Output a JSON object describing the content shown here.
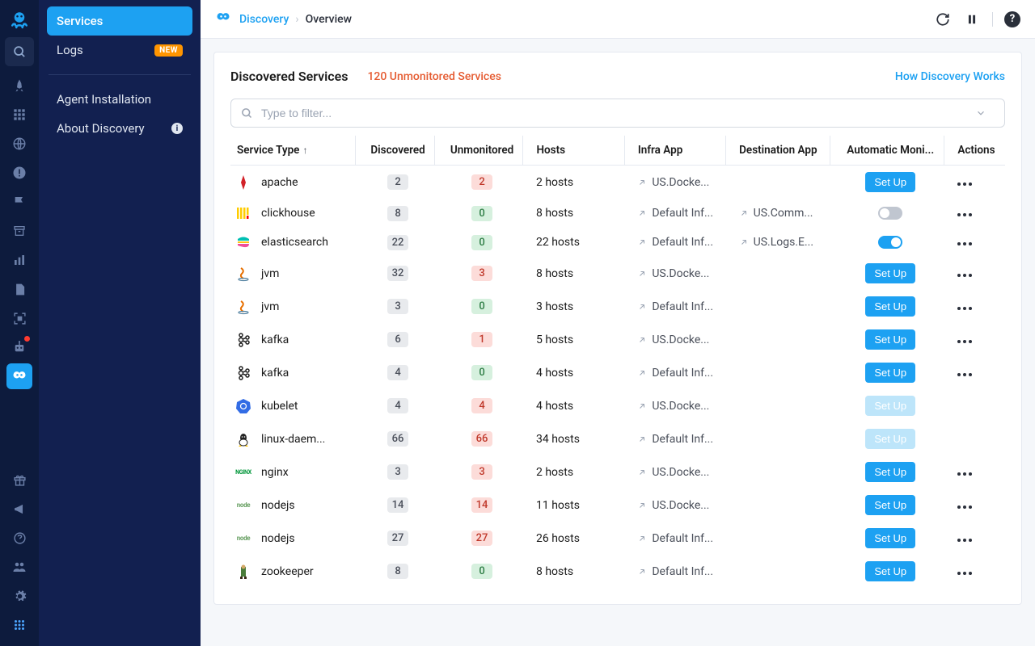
{
  "rail": {
    "icons": [
      "rocket",
      "grid",
      "globe",
      "alert",
      "flag",
      "archive",
      "chart",
      "file",
      "selection",
      "robot",
      "discovery"
    ],
    "bottom_icons": [
      "gift",
      "megaphone",
      "help",
      "people",
      "gear",
      "app"
    ]
  },
  "sidenav": {
    "items": [
      {
        "label": "Services",
        "active": true
      },
      {
        "label": "Logs",
        "badge": "NEW"
      },
      {
        "label": "Agent Installation"
      },
      {
        "label": "About Discovery",
        "info": true
      }
    ]
  },
  "breadcrumb": {
    "root": "Discovery",
    "current": "Overview"
  },
  "panel": {
    "title": "Discovered Services",
    "subtitle": "120 Unmonitored Services",
    "link": "How Discovery Works",
    "filter_placeholder": "Type to filter..."
  },
  "columns": {
    "service_type": "Service Type",
    "discovered": "Discovered",
    "unmonitored": "Unmonitored",
    "hosts": "Hosts",
    "infra_app": "Infra App",
    "destination_app": "Destination App",
    "auto_monitoring": "Automatic Moni...",
    "actions": "Actions",
    "setup_label": "Set Up"
  },
  "rows": [
    {
      "name": "apache",
      "discovered": 2,
      "unmonitored": 2,
      "unmon_color": "red",
      "hosts": "2 hosts",
      "infra": "US.Docke...",
      "dest": "",
      "control": "setup",
      "actions": true,
      "icon": "apache"
    },
    {
      "name": "clickhouse",
      "discovered": 8,
      "unmonitored": 0,
      "unmon_color": "green",
      "hosts": "8 hosts",
      "infra": "Default Inf...",
      "dest": "US.Comm...",
      "control": "toggle-off",
      "actions": true,
      "icon": "clickhouse"
    },
    {
      "name": "elasticsearch",
      "discovered": 22,
      "unmonitored": 0,
      "unmon_color": "green",
      "hosts": "22 hosts",
      "infra": "Default Inf...",
      "dest": "US.Logs.E...",
      "control": "toggle-on",
      "actions": true,
      "icon": "elasticsearch"
    },
    {
      "name": "jvm",
      "discovered": 32,
      "unmonitored": 3,
      "unmon_color": "red",
      "hosts": "8 hosts",
      "infra": "US.Docke...",
      "dest": "",
      "control": "setup",
      "actions": true,
      "icon": "jvm"
    },
    {
      "name": "jvm",
      "discovered": 3,
      "unmonitored": 0,
      "unmon_color": "green",
      "hosts": "3 hosts",
      "infra": "Default Inf...",
      "dest": "",
      "control": "setup",
      "actions": true,
      "icon": "jvm"
    },
    {
      "name": "kafka",
      "discovered": 6,
      "unmonitored": 1,
      "unmon_color": "red",
      "hosts": "5 hosts",
      "infra": "US.Docke...",
      "dest": "",
      "control": "setup",
      "actions": true,
      "icon": "kafka"
    },
    {
      "name": "kafka",
      "discovered": 4,
      "unmonitored": 0,
      "unmon_color": "green",
      "hosts": "4 hosts",
      "infra": "Default Inf...",
      "dest": "",
      "control": "setup",
      "actions": true,
      "icon": "kafka"
    },
    {
      "name": "kubelet",
      "discovered": 4,
      "unmonitored": 4,
      "unmon_color": "red",
      "hosts": "4 hosts",
      "infra": "US.Docke...",
      "dest": "",
      "control": "setup-disabled",
      "actions": false,
      "icon": "kubelet"
    },
    {
      "name": "linux-daem...",
      "discovered": 66,
      "unmonitored": 66,
      "unmon_color": "red",
      "hosts": "34 hosts",
      "infra": "Default Inf...",
      "dest": "",
      "control": "setup-disabled",
      "actions": false,
      "icon": "linux"
    },
    {
      "name": "nginx",
      "discovered": 3,
      "unmonitored": 3,
      "unmon_color": "red",
      "hosts": "2 hosts",
      "infra": "US.Docke...",
      "dest": "",
      "control": "setup",
      "actions": true,
      "icon": "nginx"
    },
    {
      "name": "nodejs",
      "discovered": 14,
      "unmonitored": 14,
      "unmon_color": "red",
      "hosts": "11 hosts",
      "infra": "US.Docke...",
      "dest": "",
      "control": "setup",
      "actions": true,
      "icon": "nodejs"
    },
    {
      "name": "nodejs",
      "discovered": 27,
      "unmonitored": 27,
      "unmon_color": "red",
      "hosts": "26 hosts",
      "infra": "Default Inf...",
      "dest": "",
      "control": "setup",
      "actions": true,
      "icon": "nodejs"
    },
    {
      "name": "zookeeper",
      "discovered": 8,
      "unmonitored": 0,
      "unmon_color": "green",
      "hosts": "8 hosts",
      "infra": "Default Inf...",
      "dest": "",
      "control": "setup",
      "actions": true,
      "icon": "zookeeper"
    }
  ]
}
